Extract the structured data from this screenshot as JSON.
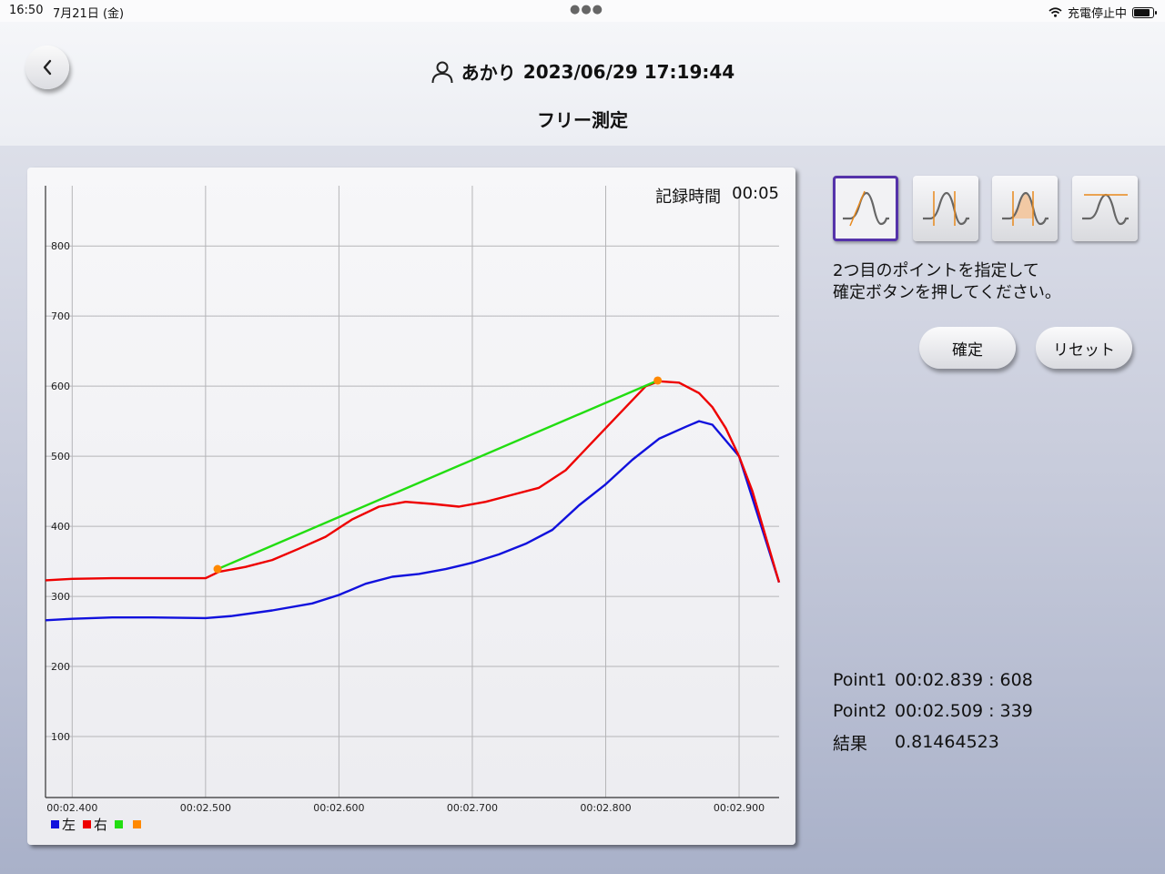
{
  "status_bar": {
    "time": "16:50",
    "date": "7月21日 (金)",
    "charging": "充電停止中"
  },
  "header": {
    "user_name": "あかり",
    "datetime": "2023/06/29 17:19:44",
    "title": "フリー測定",
    "back_icon": "chevron-left-icon"
  },
  "chart": {
    "record_time_label": "記録時間",
    "record_time_value": "00:05"
  },
  "chart_data": {
    "type": "line",
    "x_ticks": [
      "00:02.400",
      "00:02.500",
      "00:02.600",
      "00:02.700",
      "00:02.800",
      "00:02.900"
    ],
    "y_ticks": [
      "100",
      "200",
      "300",
      "400",
      "500",
      "600",
      "700",
      "800"
    ],
    "xlim": [
      2.38,
      2.93
    ],
    "ylim": [
      13,
      886
    ],
    "grid": true,
    "legend_position": "bottom-left",
    "series": [
      {
        "name": "左",
        "color": "#1111dd",
        "x": [
          2.38,
          2.4,
          2.43,
          2.46,
          2.5,
          2.52,
          2.55,
          2.58,
          2.6,
          2.62,
          2.64,
          2.66,
          2.68,
          2.7,
          2.72,
          2.74,
          2.76,
          2.78,
          2.8,
          2.82,
          2.84,
          2.86,
          2.87,
          2.88,
          2.9,
          2.91,
          2.93
        ],
        "y": [
          266,
          268,
          270,
          270,
          269,
          272,
          280,
          290,
          302,
          318,
          328,
          332,
          339,
          348,
          360,
          375,
          395,
          430,
          460,
          495,
          525,
          542,
          550,
          545,
          500,
          440,
          320
        ]
      },
      {
        "name": "右",
        "color": "#ee0000",
        "x": [
          2.38,
          2.4,
          2.43,
          2.46,
          2.5,
          2.51,
          2.53,
          2.55,
          2.57,
          2.59,
          2.61,
          2.63,
          2.65,
          2.67,
          2.69,
          2.71,
          2.73,
          2.75,
          2.77,
          2.79,
          2.81,
          2.83,
          2.84,
          2.855,
          2.87,
          2.88,
          2.89,
          2.9,
          2.91,
          2.93
        ],
        "y": [
          323,
          325,
          326,
          326,
          326,
          335,
          342,
          352,
          368,
          385,
          410,
          428,
          435,
          432,
          428,
          435,
          445,
          455,
          480,
          520,
          560,
          600,
          607,
          605,
          590,
          570,
          540,
          500,
          450,
          320
        ]
      },
      {
        "name": "",
        "color": "#22dd11",
        "x": [
          2.509,
          2.839
        ],
        "y": [
          339,
          608
        ]
      },
      {
        "name": "",
        "color": "#ff8800",
        "x": [
          2.509,
          2.839
        ],
        "y": [
          339,
          608
        ]
      }
    ]
  },
  "mode_buttons": [
    {
      "name": "wave-mode-1-icon",
      "selected": true
    },
    {
      "name": "wave-mode-2-icon",
      "selected": false
    },
    {
      "name": "wave-mode-3-icon",
      "selected": false
    },
    {
      "name": "wave-mode-4-icon",
      "selected": false
    }
  ],
  "instruction": {
    "line1": "2つ目のポイントを指定して",
    "line2": "確定ボタンを押してください。"
  },
  "buttons": {
    "confirm": "確定",
    "reset": "リセット"
  },
  "results": {
    "point1_label": "Point1",
    "point1_value": "00:02.839 : 608",
    "point2_label": "Point2",
    "point2_value": "00:02.509 : 339",
    "result_label": "結果",
    "result_value": "0.81464523"
  }
}
